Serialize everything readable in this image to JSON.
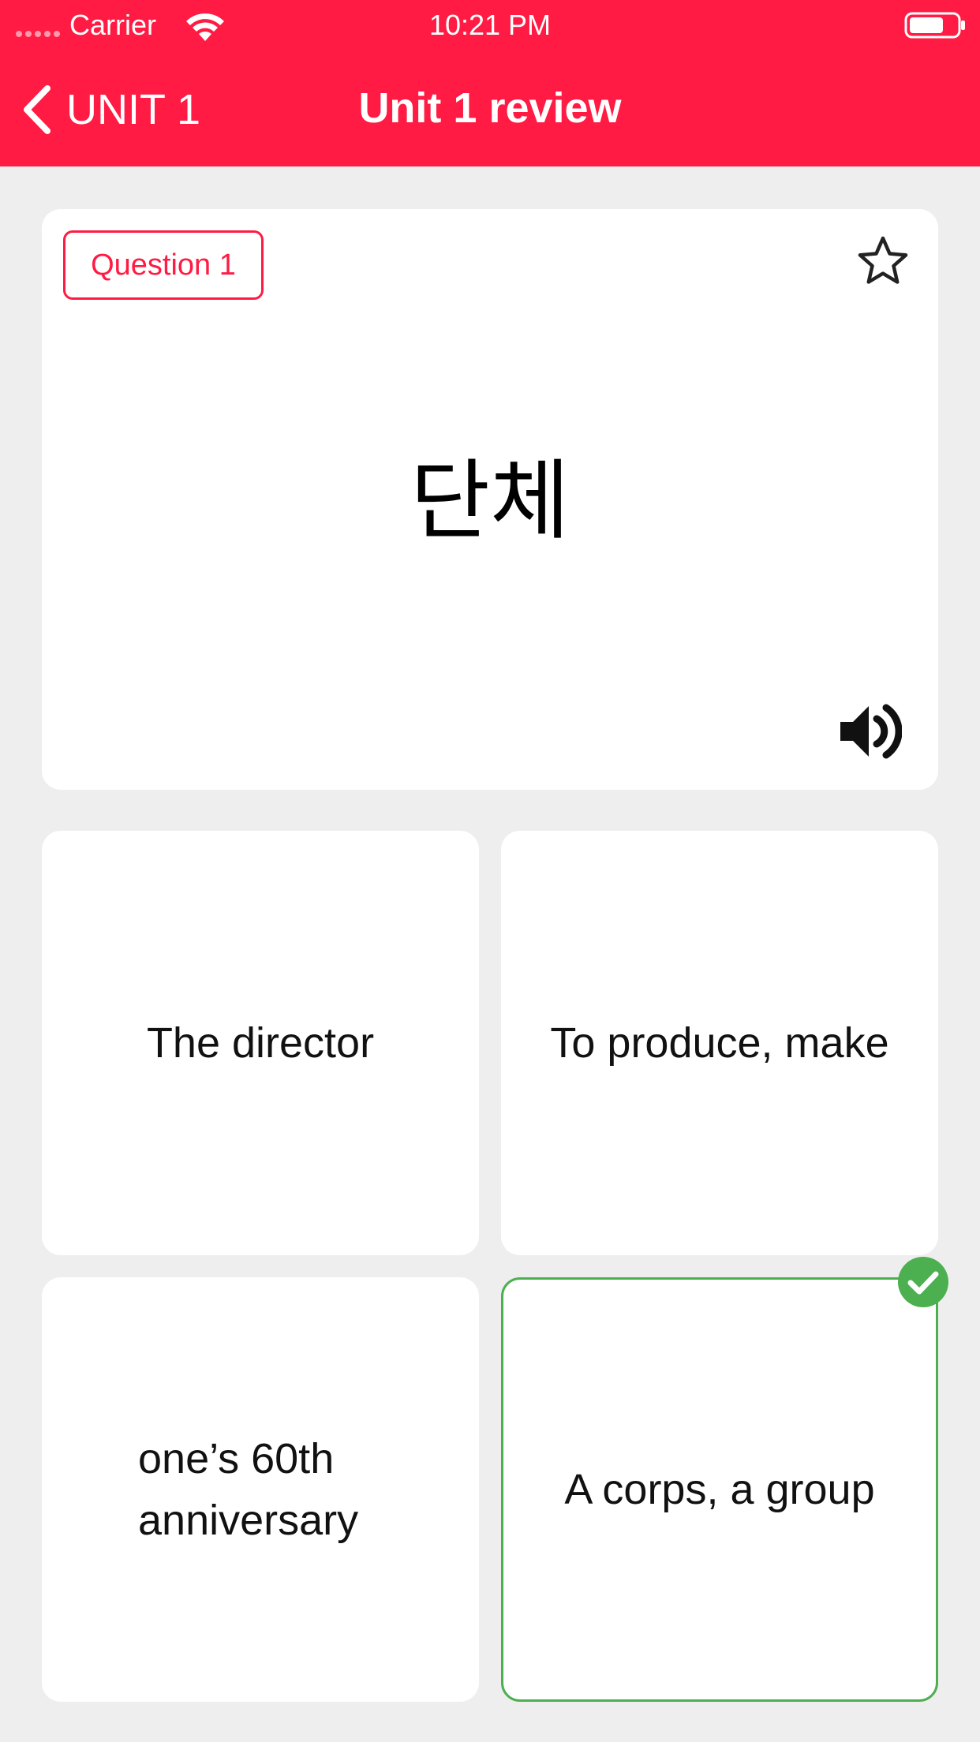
{
  "status_bar": {
    "carrier": "Carrier",
    "time": "10:21 PM",
    "wifi_icon": "wifi-icon",
    "battery_icon": "battery-icon"
  },
  "nav": {
    "back_label": "UNIT 1",
    "back_icon": "chevron-left-icon",
    "title": "Unit 1 review"
  },
  "question": {
    "badge": "Question 1",
    "word": "단체",
    "star_icon": "star-outline-icon",
    "speaker_icon": "speaker-icon"
  },
  "options": [
    {
      "text": "The director",
      "state": "normal"
    },
    {
      "text": "To produce, make",
      "state": "normal"
    },
    {
      "text": "one’s 60th anniversary",
      "state": "normal"
    },
    {
      "text": "A corps, a group",
      "state": "correct"
    }
  ],
  "colors": {
    "primary": "#ff1b43",
    "background": "#eeeeee",
    "card": "#ffffff",
    "correct": "#4caf50"
  }
}
